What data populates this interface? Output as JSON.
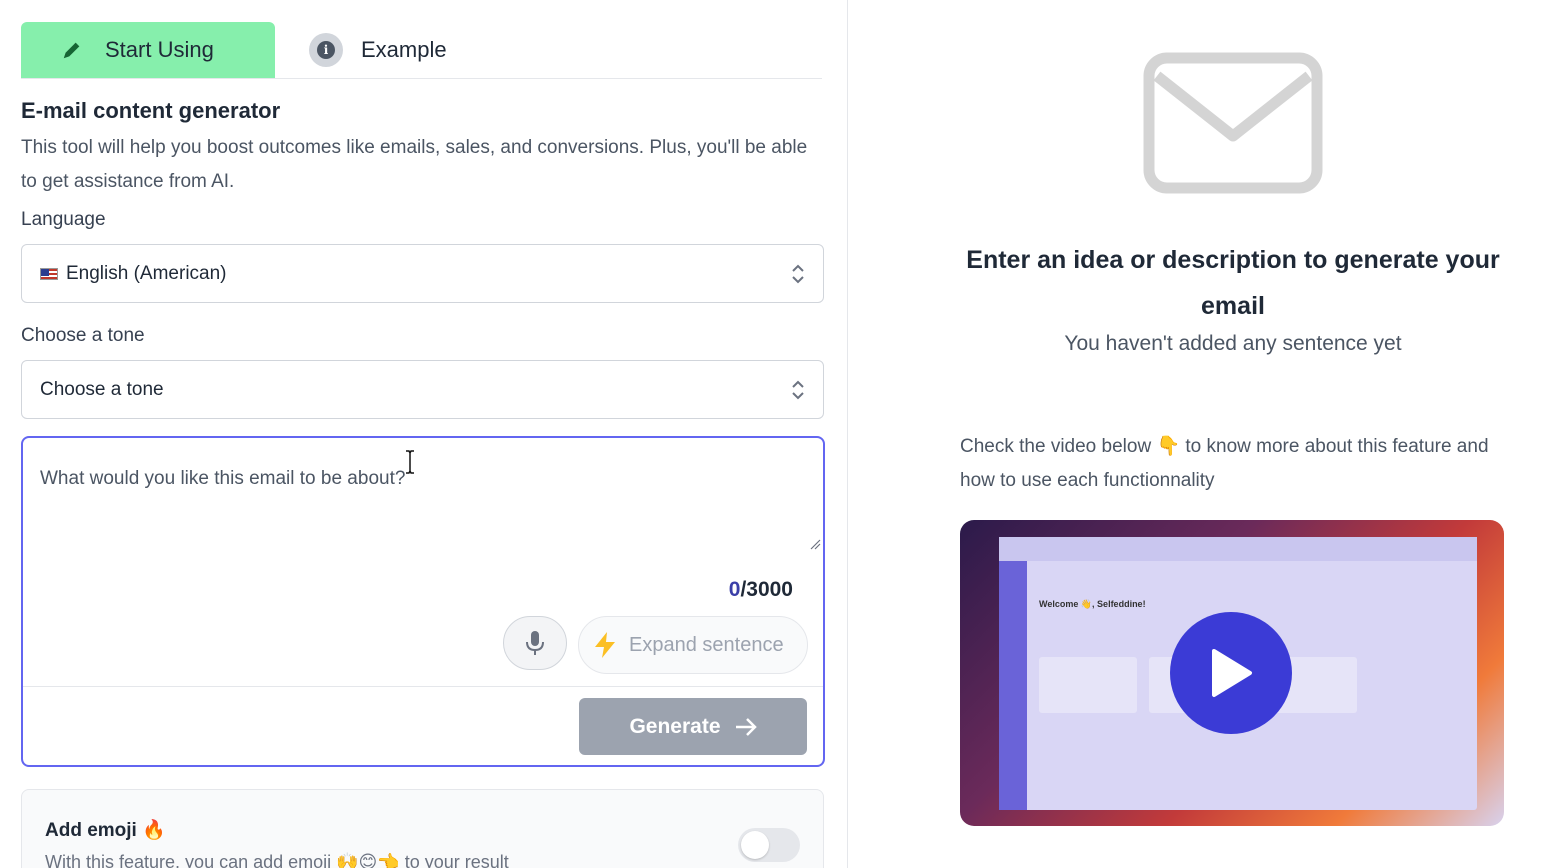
{
  "tabs": {
    "start_label": "Start Using",
    "example_label": "Example",
    "info_glyph": "i"
  },
  "form": {
    "title": "E-mail content generator",
    "description": "This tool will help you boost outcomes like emails, sales, and conversions. Plus, you'll be able to get assistance from AI.",
    "language_label": "Language",
    "language_value": "English (American)",
    "tone_label": "Choose a tone",
    "tone_value": "Choose a tone",
    "prompt_placeholder": "What would you like this email to be about?",
    "counter_current": "0",
    "counter_max": "/3000",
    "expand_label": "Expand sentence",
    "generate_label": "Generate"
  },
  "emoji": {
    "title": "Add emoji 🔥",
    "description": "With this feature, you can add emoji 🙌😊👈 to your result"
  },
  "empty_state": {
    "title": "Enter an idea or description to generate your email",
    "subtitle": "You haven't added any sentence yet",
    "video_text": "Check the video below 👇 to know more about this feature and how to use each functionnality"
  },
  "video_preview": {
    "welcome": "Welcome 👋, Selfeddine!"
  },
  "colors": {
    "tab_active": "#86efac",
    "focus_border": "#6366f1",
    "play_button": "#3b3bd6",
    "generate_disabled": "#9ca3af"
  }
}
